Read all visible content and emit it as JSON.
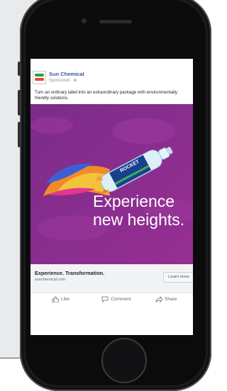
{
  "post": {
    "brand": "Sun Chemical",
    "meta": "Sponsored · ⊕",
    "caption": "Turn an ordinary label into an extraordinary package with environmentally friendly solutions."
  },
  "ad": {
    "headline_line1": "Experience",
    "headline_line2": "new heights.",
    "bottle_label": "ROCKET",
    "background_color": "#8a2b8e"
  },
  "link": {
    "title": "Experience. Transformation.",
    "url": "sunchemical.com",
    "button": "Learn more"
  },
  "actions": {
    "like": "Like",
    "comment": "Comment",
    "share": "Share"
  },
  "icons": [
    "avatar-logo",
    "globe-icon",
    "like-icon",
    "comment-icon",
    "share-icon"
  ]
}
